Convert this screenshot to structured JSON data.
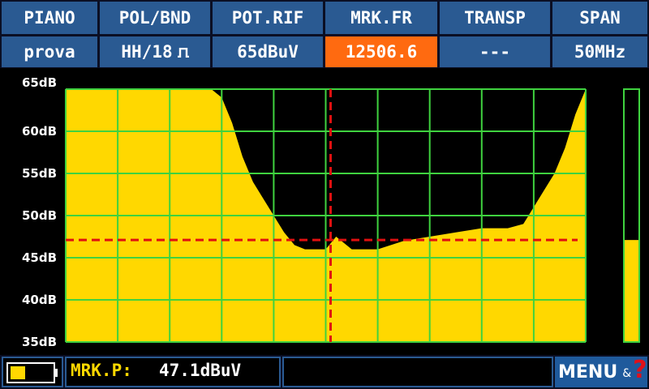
{
  "header": {
    "titles": [
      "PIANO",
      "POL/BND",
      "POT.RIF",
      "MRK.FR",
      "TRANSP",
      "SPAN"
    ],
    "values": [
      "prova",
      "HH/18",
      "65dBuV",
      "12506.6",
      "---",
      "50MHz"
    ]
  },
  "chart_data": {
    "type": "area",
    "title": "",
    "xlabel": "",
    "ylabel": "",
    "y_tick_labels": [
      "65dB",
      "60dB",
      "55dB",
      "50dB",
      "45dB",
      "40dB",
      "35dB"
    ],
    "ylim": [
      35,
      65
    ],
    "grid": true,
    "x": [
      0,
      0.05,
      0.1,
      0.15,
      0.2,
      0.25,
      0.28,
      0.3,
      0.32,
      0.34,
      0.36,
      0.38,
      0.4,
      0.42,
      0.44,
      0.46,
      0.48,
      0.5,
      0.52,
      0.55,
      0.6,
      0.65,
      0.7,
      0.75,
      0.8,
      0.85,
      0.88,
      0.9,
      0.92,
      0.94,
      0.96,
      0.98,
      1.0
    ],
    "values": [
      65,
      65,
      65,
      65,
      65,
      65,
      65,
      64,
      61,
      57,
      54,
      52,
      50,
      48,
      46.5,
      46,
      46,
      46,
      47.5,
      46,
      46,
      47,
      47.5,
      48,
      48.5,
      48.5,
      49,
      51,
      53,
      55,
      58,
      62,
      65
    ],
    "marker": {
      "freq_fraction": 0.5,
      "level": 47.1
    },
    "level_bar": 47.1,
    "colors": {
      "fill": "#ffd800",
      "grid": "#3fd23f",
      "marker": "#e01010"
    }
  },
  "footer": {
    "battery_icon": "battery-icon",
    "marker_label": "MRK.P:",
    "marker_value": "47.1dBuV",
    "menu_label": "MENU",
    "menu_amp": "&",
    "help_symbol": "?"
  }
}
